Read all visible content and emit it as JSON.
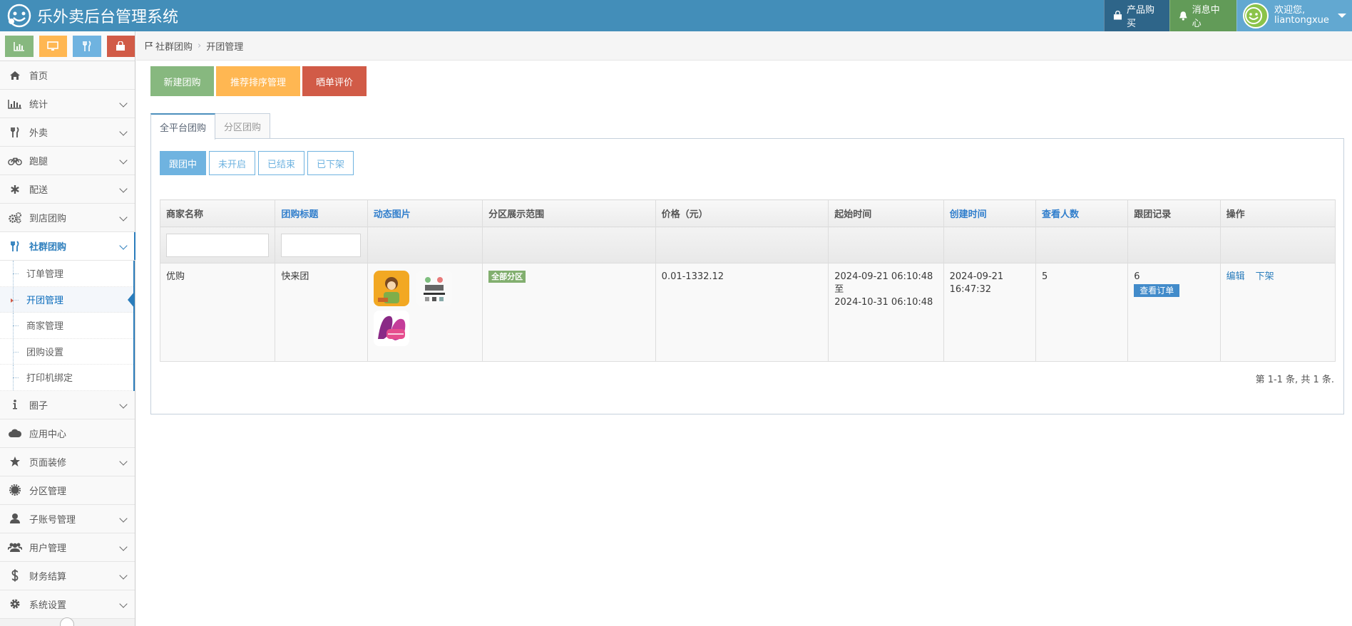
{
  "app": {
    "title": "乐外卖后台管理系统"
  },
  "topnav": {
    "buy": "产品购买",
    "messages": "消息中心",
    "welcome": "欢迎您,",
    "username": "liantongxue"
  },
  "colors": {
    "navbar": "#438eb9",
    "accent": "#2b7dbc",
    "green": "#87b87f",
    "orange": "#ffb752",
    "red": "#d15b47",
    "blue": "#6fb3e0"
  },
  "shortcuts": [
    "chart-icon",
    "desktop-icon",
    "food-icon",
    "bag-icon"
  ],
  "sidebar": {
    "items": [
      {
        "label": "首页",
        "icon": "home-icon"
      },
      {
        "label": "统计",
        "icon": "bar-chart-icon"
      },
      {
        "label": "外卖",
        "icon": "cutlery-icon"
      },
      {
        "label": "跑腿",
        "icon": "bicycle-icon"
      },
      {
        "label": "配送",
        "icon": "asterisk-icon"
      },
      {
        "label": "到店团购",
        "icon": "cogs-icon"
      },
      {
        "label": "社群团购",
        "icon": "cutlery-icon"
      },
      {
        "label": "圈子",
        "icon": "info-icon"
      },
      {
        "label": "应用中心",
        "icon": "cloud-icon"
      },
      {
        "label": "页面装修",
        "icon": "star-icon"
      },
      {
        "label": "分区管理",
        "icon": "certificate-icon"
      },
      {
        "label": "子账号管理",
        "icon": "user-icon"
      },
      {
        "label": "用户管理",
        "icon": "users-icon"
      },
      {
        "label": "财务结算",
        "icon": "dollar-icon"
      },
      {
        "label": "系统设置",
        "icon": "gear-icon"
      }
    ],
    "submenu": [
      "订单管理",
      "开团管理",
      "商家管理",
      "团购设置",
      "打印机绑定"
    ]
  },
  "breadcrumb": {
    "parent": "社群团购",
    "current": "开团管理"
  },
  "actions": {
    "new": "新建团购",
    "rank": "推荐排序管理",
    "review": "晒单评价"
  },
  "tabs": [
    "全平台团购",
    "分区团购"
  ],
  "status_filters": [
    "跟团中",
    "未开启",
    "已结束",
    "已下架"
  ],
  "table": {
    "headers": [
      "商家名称",
      "团购标题",
      "动态图片",
      "分区展示范围",
      "价格（元）",
      "起始时间",
      "创建时间",
      "查看人数",
      "跟团记录",
      "操作"
    ],
    "rows": [
      {
        "merchant": "优购",
        "title": "快来团",
        "scope": "全部分区",
        "price": "0.01-1332.12",
        "start": "2024-09-21 06:10:48",
        "to": "至",
        "end": "2024-10-31 06:10:48",
        "created_date": "2024-09-21",
        "created_time": "16:47:32",
        "views": "5",
        "records": "6",
        "view_orders": "查看订单",
        "edit": "编辑",
        "offline": "下架"
      }
    ]
  },
  "pager": "第 1-1 条, 共 1 条."
}
